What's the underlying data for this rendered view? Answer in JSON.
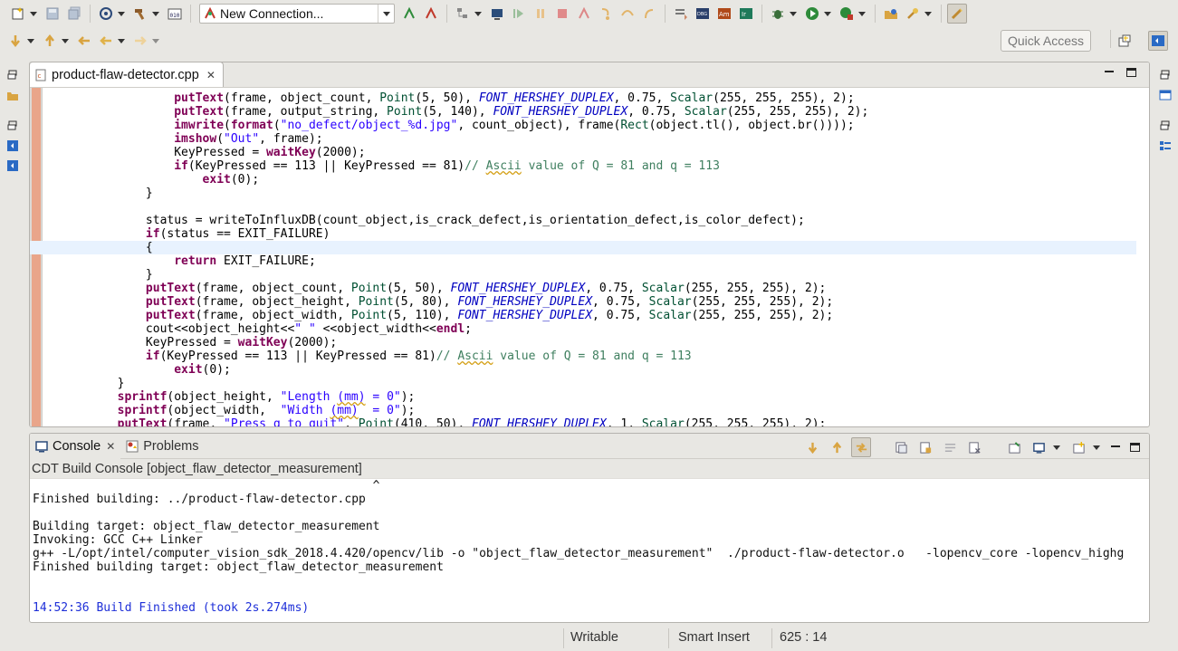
{
  "toolbar": {
    "connection": {
      "selected": "New Connection..."
    }
  },
  "quick_access": {
    "label": "Quick Access"
  },
  "editor": {
    "tab_label": "product-flaw-detector.cpp",
    "lines": [
      {
        "indent": "        ",
        "tokens": [
          [
            "fn",
            "putText"
          ],
          [
            "",
            "(frame, object_count, "
          ],
          [
            "cls",
            "Point"
          ],
          [
            "",
            "(5, 50), "
          ],
          [
            "mac",
            "FONT_HERSHEY_DUPLEX"
          ],
          [
            "",
            ", 0.75, "
          ],
          [
            "cls",
            "Scalar"
          ],
          [
            "",
            "(255, 255, 255), 2);"
          ]
        ]
      },
      {
        "indent": "        ",
        "tokens": [
          [
            "fn",
            "putText"
          ],
          [
            "",
            "(frame, output_string, "
          ],
          [
            "cls",
            "Point"
          ],
          [
            "",
            "(5, 140), "
          ],
          [
            "mac",
            "FONT_HERSHEY_DUPLEX"
          ],
          [
            "",
            ", 0.75, "
          ],
          [
            "cls",
            "Scalar"
          ],
          [
            "",
            "(255, 255, 255), 2);"
          ]
        ]
      },
      {
        "indent": "        ",
        "tokens": [
          [
            "fn",
            "imwrite"
          ],
          [
            "",
            "("
          ],
          [
            "fn",
            "format"
          ],
          [
            "",
            "("
          ],
          [
            "str",
            "\"no_defect/object_%d.jpg\""
          ],
          [
            "",
            ", count_object), frame("
          ],
          [
            "cls",
            "Rect"
          ],
          [
            "",
            "(object.tl(), object.br())));"
          ]
        ]
      },
      {
        "indent": "        ",
        "tokens": [
          [
            "fn",
            "imshow"
          ],
          [
            "",
            "("
          ],
          [
            "str",
            "\"Out\""
          ],
          [
            "",
            ", frame);"
          ]
        ]
      },
      {
        "indent": "        ",
        "tokens": [
          [
            "",
            "KeyPressed = "
          ],
          [
            "fn",
            "waitKey"
          ],
          [
            "",
            "(2000);"
          ]
        ]
      },
      {
        "indent": "        ",
        "tokens": [
          [
            "kw",
            "if"
          ],
          [
            "",
            "(KeyPressed == 113 || KeyPressed == 81)"
          ],
          [
            "cmt",
            "// "
          ],
          [
            "cmtsq",
            "Ascii"
          ],
          [
            "cmt",
            " value of Q = 81 and q = 113"
          ]
        ]
      },
      {
        "indent": "            ",
        "tokens": [
          [
            "fn",
            "exit"
          ],
          [
            "",
            "(0);"
          ]
        ]
      },
      {
        "indent": "    ",
        "tokens": [
          [
            "",
            "}"
          ]
        ]
      },
      {
        "indent": "",
        "tokens": [
          [
            "",
            ""
          ]
        ]
      },
      {
        "indent": "    ",
        "tokens": [
          [
            "",
            "status = writeToInfluxDB(count_object,is_crack_defect,is_orientation_defect,is_color_defect);"
          ]
        ]
      },
      {
        "indent": "    ",
        "tokens": [
          [
            "kw",
            "if"
          ],
          [
            "",
            "(status == EXIT_FAILURE)"
          ]
        ]
      },
      {
        "indent": "    ",
        "current": true,
        "tokens": [
          [
            "",
            "{"
          ]
        ]
      },
      {
        "indent": "        ",
        "tokens": [
          [
            "kw",
            "return"
          ],
          [
            "",
            " EXIT_FAILURE;"
          ]
        ]
      },
      {
        "indent": "    ",
        "tokens": [
          [
            "",
            "}"
          ]
        ]
      },
      {
        "indent": "    ",
        "tokens": [
          [
            "fn",
            "putText"
          ],
          [
            "",
            "(frame, object_count, "
          ],
          [
            "cls",
            "Point"
          ],
          [
            "",
            "(5, 50), "
          ],
          [
            "mac",
            "FONT_HERSHEY_DUPLEX"
          ],
          [
            "",
            ", 0.75, "
          ],
          [
            "cls",
            "Scalar"
          ],
          [
            "",
            "(255, 255, 255), 2);"
          ]
        ]
      },
      {
        "indent": "    ",
        "tokens": [
          [
            "fn",
            "putText"
          ],
          [
            "",
            "(frame, object_height, "
          ],
          [
            "cls",
            "Point"
          ],
          [
            "",
            "(5, 80), "
          ],
          [
            "mac",
            "FONT_HERSHEY_DUPLEX"
          ],
          [
            "",
            ", 0.75, "
          ],
          [
            "cls",
            "Scalar"
          ],
          [
            "",
            "(255, 255, 255), 2);"
          ]
        ]
      },
      {
        "indent": "    ",
        "tokens": [
          [
            "fn",
            "putText"
          ],
          [
            "",
            "(frame, object_width, "
          ],
          [
            "cls",
            "Point"
          ],
          [
            "",
            "(5, 110), "
          ],
          [
            "mac",
            "FONT_HERSHEY_DUPLEX"
          ],
          [
            "",
            ", 0.75, "
          ],
          [
            "cls",
            "Scalar"
          ],
          [
            "",
            "(255, 255, 255), 2);"
          ]
        ]
      },
      {
        "indent": "    ",
        "tokens": [
          [
            "",
            "cout<<object_height<<"
          ],
          [
            "str",
            "\" \""
          ],
          [
            "",
            " <<object_width<<"
          ],
          [
            "kw",
            "endl"
          ],
          [
            "",
            ";"
          ]
        ]
      },
      {
        "indent": "    ",
        "tokens": [
          [
            "",
            "KeyPressed = "
          ],
          [
            "fn",
            "waitKey"
          ],
          [
            "",
            "(2000);"
          ]
        ]
      },
      {
        "indent": "    ",
        "tokens": [
          [
            "kw",
            "if"
          ],
          [
            "",
            "(KeyPressed == 113 || KeyPressed == 81)"
          ],
          [
            "cmt",
            "// "
          ],
          [
            "cmtsq",
            "Ascii"
          ],
          [
            "cmt",
            " value of Q = 81 and q = 113"
          ]
        ]
      },
      {
        "indent": "        ",
        "tokens": [
          [
            "fn",
            "exit"
          ],
          [
            "",
            "(0);"
          ]
        ]
      },
      {
        "indent": "",
        "tokens": [
          [
            "",
            "}"
          ]
        ]
      },
      {
        "indent": "",
        "tokens": [
          [
            "fn",
            "sprintf"
          ],
          [
            "",
            "(object_height, "
          ],
          [
            "str",
            "\"Length "
          ],
          [
            "strsq",
            "(mm)"
          ],
          [
            "str",
            " = 0\""
          ],
          [
            "",
            ");"
          ]
        ]
      },
      {
        "indent": "",
        "tokens": [
          [
            "fn",
            "sprintf"
          ],
          [
            "",
            "(object_width,  "
          ],
          [
            "str",
            "\"Width "
          ],
          [
            "strsq",
            "(mm)"
          ],
          [
            "str",
            "  = 0\""
          ],
          [
            "",
            ");"
          ]
        ]
      },
      {
        "indent": "",
        "tokens": [
          [
            "fn",
            "putText"
          ],
          [
            "",
            "(frame, "
          ],
          [
            "str",
            "\"Press q to quit\""
          ],
          [
            "",
            ", "
          ],
          [
            "cls",
            "Point"
          ],
          [
            "",
            "(410, 50), "
          ],
          [
            "mac",
            "FONT_HERSHEY_DUPLEX"
          ],
          [
            "",
            ", 1, "
          ],
          [
            "cls",
            "Scalar"
          ],
          [
            "",
            "(255, 255, 255), 2);"
          ]
        ]
      }
    ],
    "base_indent": "        "
  },
  "console": {
    "tab_console": "Console",
    "tab_problems": "Problems",
    "title": "CDT Build Console [object_flaw_detector_measurement]",
    "lines": [
      {
        "text": "                                                ^",
        "color": ""
      },
      {
        "text": "Finished building: ../product-flaw-detector.cpp",
        "color": ""
      },
      {
        "text": " ",
        "color": ""
      },
      {
        "text": "Building target: object_flaw_detector_measurement",
        "color": ""
      },
      {
        "text": "Invoking: GCC C++ Linker",
        "color": ""
      },
      {
        "text": "g++ -L/opt/intel/computer_vision_sdk_2018.4.420/opencv/lib -o \"object_flaw_detector_measurement\"  ./product-flaw-detector.o   -lopencv_core -lopencv_highg",
        "color": ""
      },
      {
        "text": "Finished building target: object_flaw_detector_measurement",
        "color": ""
      },
      {
        "text": " ",
        "color": ""
      },
      {
        "text": " ",
        "color": ""
      },
      {
        "text": "14:52:36 Build Finished (took 2s.274ms)",
        "color": "blue"
      }
    ]
  },
  "status": {
    "writable": "Writable",
    "insert_mode": "Smart Insert",
    "position": "625 : 14"
  }
}
